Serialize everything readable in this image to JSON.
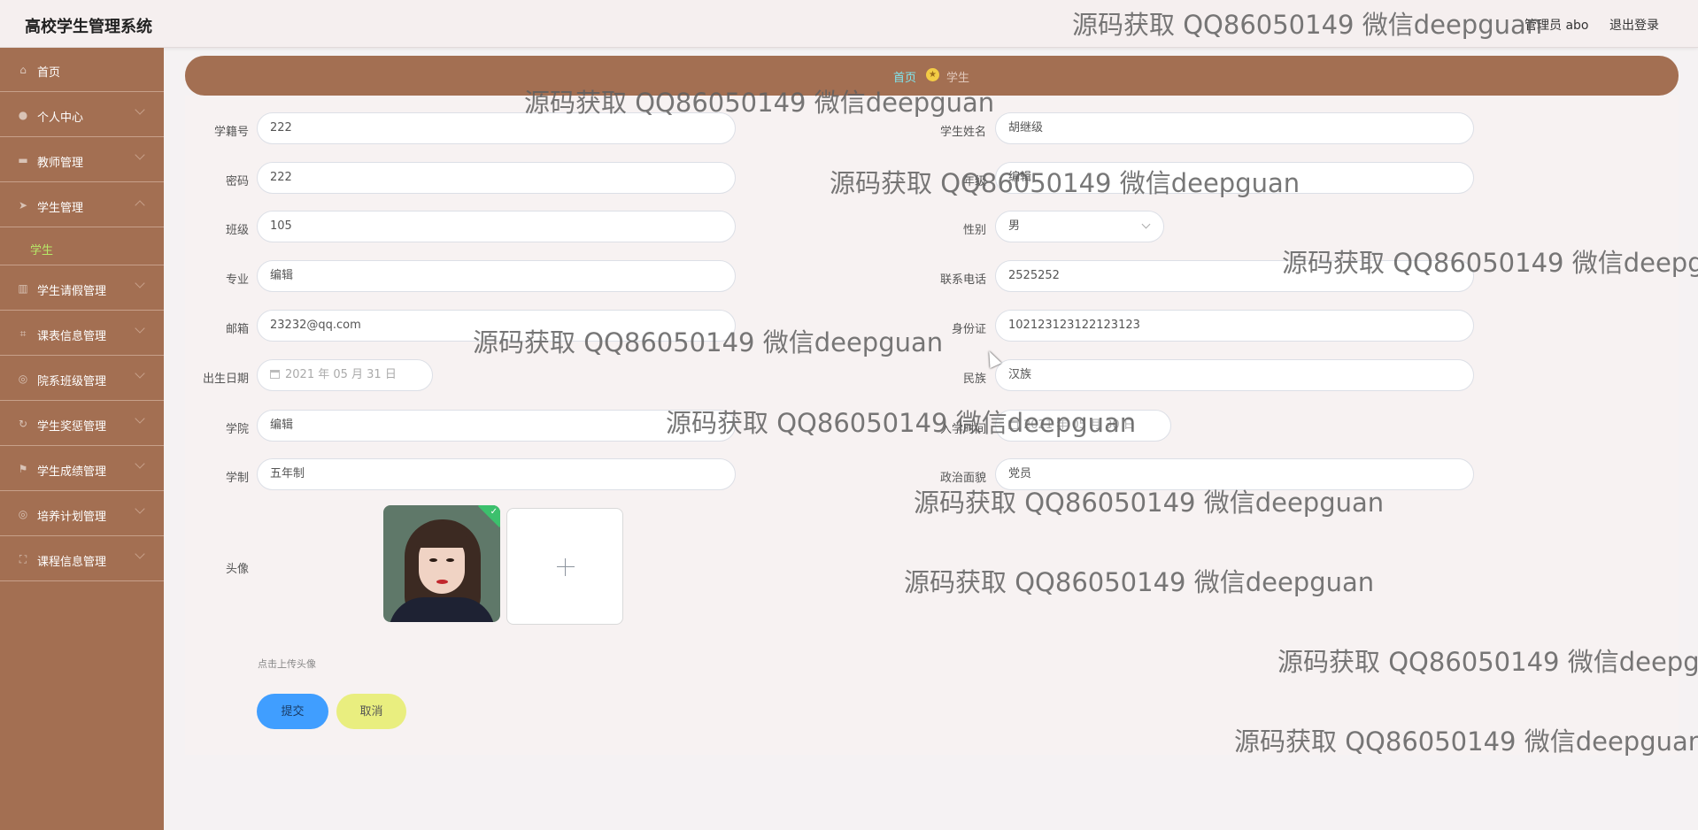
{
  "header": {
    "app_title": "高校学生管理系统",
    "admin_label": "管理员 abo",
    "logout_label": "退出登录"
  },
  "sidebar": {
    "items": [
      {
        "label": "首页",
        "icon": "home-icon"
      },
      {
        "label": "个人中心",
        "icon": "user-icon"
      },
      {
        "label": "教师管理",
        "icon": "briefcase-icon"
      },
      {
        "label": "学生管理",
        "icon": "send-icon",
        "expanded": true
      },
      {
        "label": "学生请假管理",
        "icon": "chart-icon"
      },
      {
        "label": "课表信息管理",
        "icon": "crop-icon"
      },
      {
        "label": "院系班级管理",
        "icon": "globe-icon"
      },
      {
        "label": "学生奖惩管理",
        "icon": "refresh-icon"
      },
      {
        "label": "学生成绩管理",
        "icon": "flag-icon"
      },
      {
        "label": "培养计划管理",
        "icon": "globe-icon"
      },
      {
        "label": "课程信息管理",
        "icon": "fullscreen-icon"
      }
    ],
    "active_subitem": "学生"
  },
  "breadcrumb": {
    "home": "首页",
    "current": "学生"
  },
  "form": {
    "labels": {
      "student_no": "学籍号",
      "password": "密码",
      "class": "班级",
      "major": "专业",
      "email": "邮箱",
      "birth_date": "出生日期",
      "college": "学院",
      "duration": "学制",
      "avatar": "头像",
      "name": "学生姓名",
      "grade": "年级",
      "gender": "性别",
      "phone": "联系电话",
      "id_card": "身份证",
      "ethnicity": "民族",
      "enroll_date": "入学时间",
      "political": "政治面貌"
    },
    "values": {
      "student_no": "222",
      "password": "222",
      "class": "105",
      "major": "编辑",
      "email": "23232@qq.com",
      "birth_date": "2021 年 05 月 31 日",
      "college": "编辑",
      "duration": "五年制",
      "name": "胡继级",
      "grade": "编辑",
      "gender": "男",
      "phone": "2525252",
      "id_card": "102123123122123123",
      "ethnicity": "汉族",
      "enroll_date": "2021 年 05 月 30 日",
      "political": "党员"
    },
    "upload_tip": "点击上传头像",
    "submit_label": "提交",
    "cancel_label": "取消"
  },
  "watermark_text": "源码获取 QQ86050149 微信deepguan",
  "colors": {
    "sidebar": "#a36f52",
    "breadcrumb_home": "#7fe7f0",
    "active_subitem": "#b7e868",
    "submit": "#409eff",
    "cancel": "#e9ee7f"
  }
}
